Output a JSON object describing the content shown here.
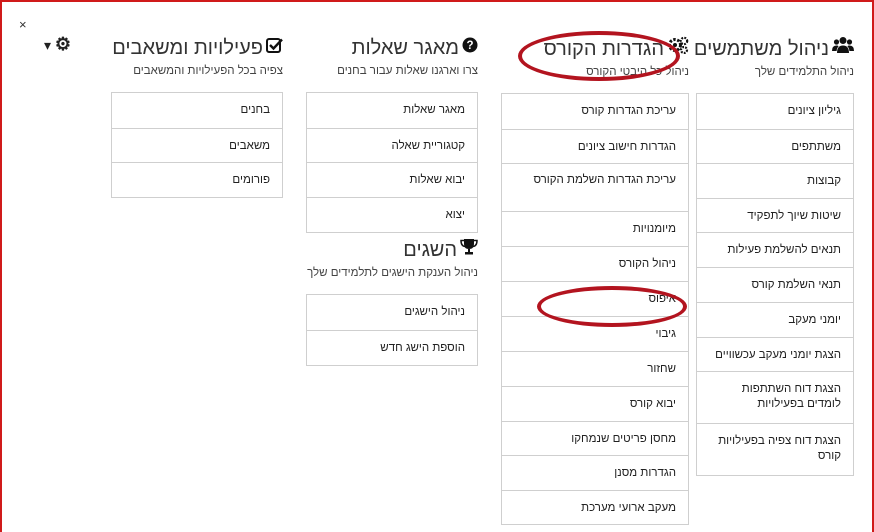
{
  "controls": {
    "close_glyph": "×",
    "gear_glyph": "⚙",
    "caret_glyph": "▾"
  },
  "users": {
    "title": "ניהול משתמשים",
    "subtitle": "ניהול התלמידים שלך",
    "icon": "users-icon",
    "items": [
      "גיליון ציונים",
      "משתתפים",
      "קבוצות",
      "שיטות שיוך לתפקיד",
      "תנאים להשלמת פעילות",
      "תנאי השלמת קורס",
      "יומני מעקב",
      "הצגת יומני מעקב עכשוויים",
      "הצגת דוח השתתפות לומדים בפעילויות",
      "הצגת דוח צפיה בפעילויות קורס"
    ]
  },
  "course": {
    "title": "הגדרות הקורס",
    "subtitle": "ניהול כל היבטי הקורס",
    "icon": "cogs-icon",
    "items": [
      "עריכת הגדרות קורס",
      "הגדרות חישוב ציונים",
      "עריכת הגדרות השלמת הקורס",
      "מיומנויות",
      "ניהול הקורס",
      "איפוס",
      "גיבוי",
      "שחזור",
      "יבוא קורס",
      "מחסן פריטים שנמחקו",
      "הגדרות מסנן",
      "מעקב ארועי מערכת"
    ]
  },
  "questions": {
    "title": "מאגר שאלות",
    "subtitle": "צרו וארגנו שאלות עבור בחנים",
    "icon": "question-circle-icon",
    "items": [
      "מאגר שאלות",
      "קטגוריית שאלה",
      "יבוא שאלות",
      "יצוא"
    ]
  },
  "badges": {
    "title": "השגים",
    "subtitle": "ניהול הענקת הישגים לתלמידים שלך",
    "icon": "trophy-icon",
    "items": [
      "ניהול הישגים",
      "הוספת הישג חדש"
    ]
  },
  "activities": {
    "title": "פעילויות ומשאבים",
    "subtitle": "צפיה בכל הפעילויות והמשאבים",
    "icon": "check-square-icon",
    "items": [
      "בחנים",
      "משאבים",
      "פורומים"
    ]
  }
}
